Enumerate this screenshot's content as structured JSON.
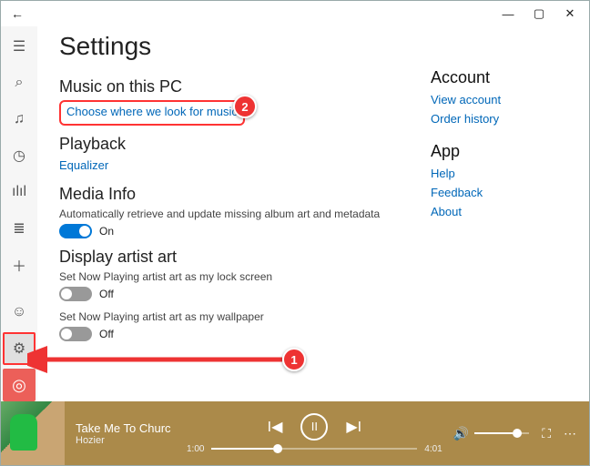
{
  "page_title": "Settings",
  "sections": {
    "music": {
      "heading": "Music on this PC",
      "choose_link": "Choose where we look for music"
    },
    "playback": {
      "heading": "Playback",
      "equalizer_link": "Equalizer"
    },
    "mediainfo": {
      "heading": "Media Info",
      "desc": "Automatically retrieve and update missing album art and metadata",
      "toggle_state": "On"
    },
    "artistart": {
      "heading": "Display artist art",
      "lock_desc": "Set Now Playing artist art as my lock screen",
      "lock_state": "Off",
      "wall_desc": "Set Now Playing artist art as my wallpaper",
      "wall_state": "Off"
    }
  },
  "side": {
    "account_heading": "Account",
    "view_account": "View account",
    "order_history": "Order history",
    "app_heading": "App",
    "help": "Help",
    "feedback": "Feedback",
    "about": "About"
  },
  "player": {
    "title": "Take Me To Churc",
    "artist": "Hozier",
    "elapsed": "1:00",
    "total": "4:01"
  },
  "callouts": {
    "one": "1",
    "two": "2"
  }
}
